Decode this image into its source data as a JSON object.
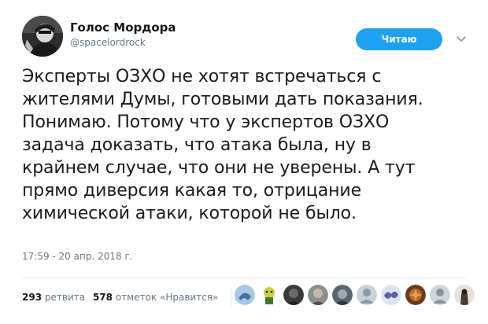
{
  "author": {
    "display_name": "Голос Мордора",
    "username": "@spacelordrock",
    "avatar_icon": "user-avatar-photo"
  },
  "actions": {
    "follow_label": "Читаю",
    "more_icon": "chevron-down-icon"
  },
  "tweet": {
    "lines": [
      "Эксперты ОЗХО не хотят встречаться с",
      "жителями Думы, готовыми дать показания.",
      "Понимаю. Потому что у экспертов ОЗХО",
      "задача доказать, что атака была, ну в",
      "крайнем случае, что они не уверены. А тут",
      "прямо диверсия какая то, отрицание",
      "химической атаки, которой не было."
    ],
    "timestamp": "17:59 - 20 апр. 2018 г."
  },
  "stats": {
    "retweets_count": "293",
    "retweets_label": "ретвита",
    "likes_count": "578",
    "likes_label": "отметок «Нравится»"
  },
  "likers": [
    {
      "icon": "liker-avatar-1",
      "color": "#a6c8e8"
    },
    {
      "icon": "liker-avatar-2",
      "color": "#c9d33a"
    },
    {
      "icon": "liker-avatar-3",
      "color": "#3a3a3a"
    },
    {
      "icon": "liker-avatar-4",
      "color": "#8a8f90"
    },
    {
      "icon": "liker-avatar-5",
      "color": "#5a6570"
    },
    {
      "icon": "liker-avatar-6",
      "color": "#c8d0d8"
    },
    {
      "icon": "liker-avatar-7",
      "color": "#5b5fa8"
    },
    {
      "icon": "liker-avatar-8",
      "color": "#b86a2a"
    },
    {
      "icon": "liker-avatar-9",
      "color": "#d0d5da"
    },
    {
      "icon": "liker-avatar-10",
      "color": "#4a3a30"
    }
  ],
  "colors": {
    "accent": "#1da1f2",
    "secondary_text": "#657786",
    "divider": "#e1e8ed"
  }
}
